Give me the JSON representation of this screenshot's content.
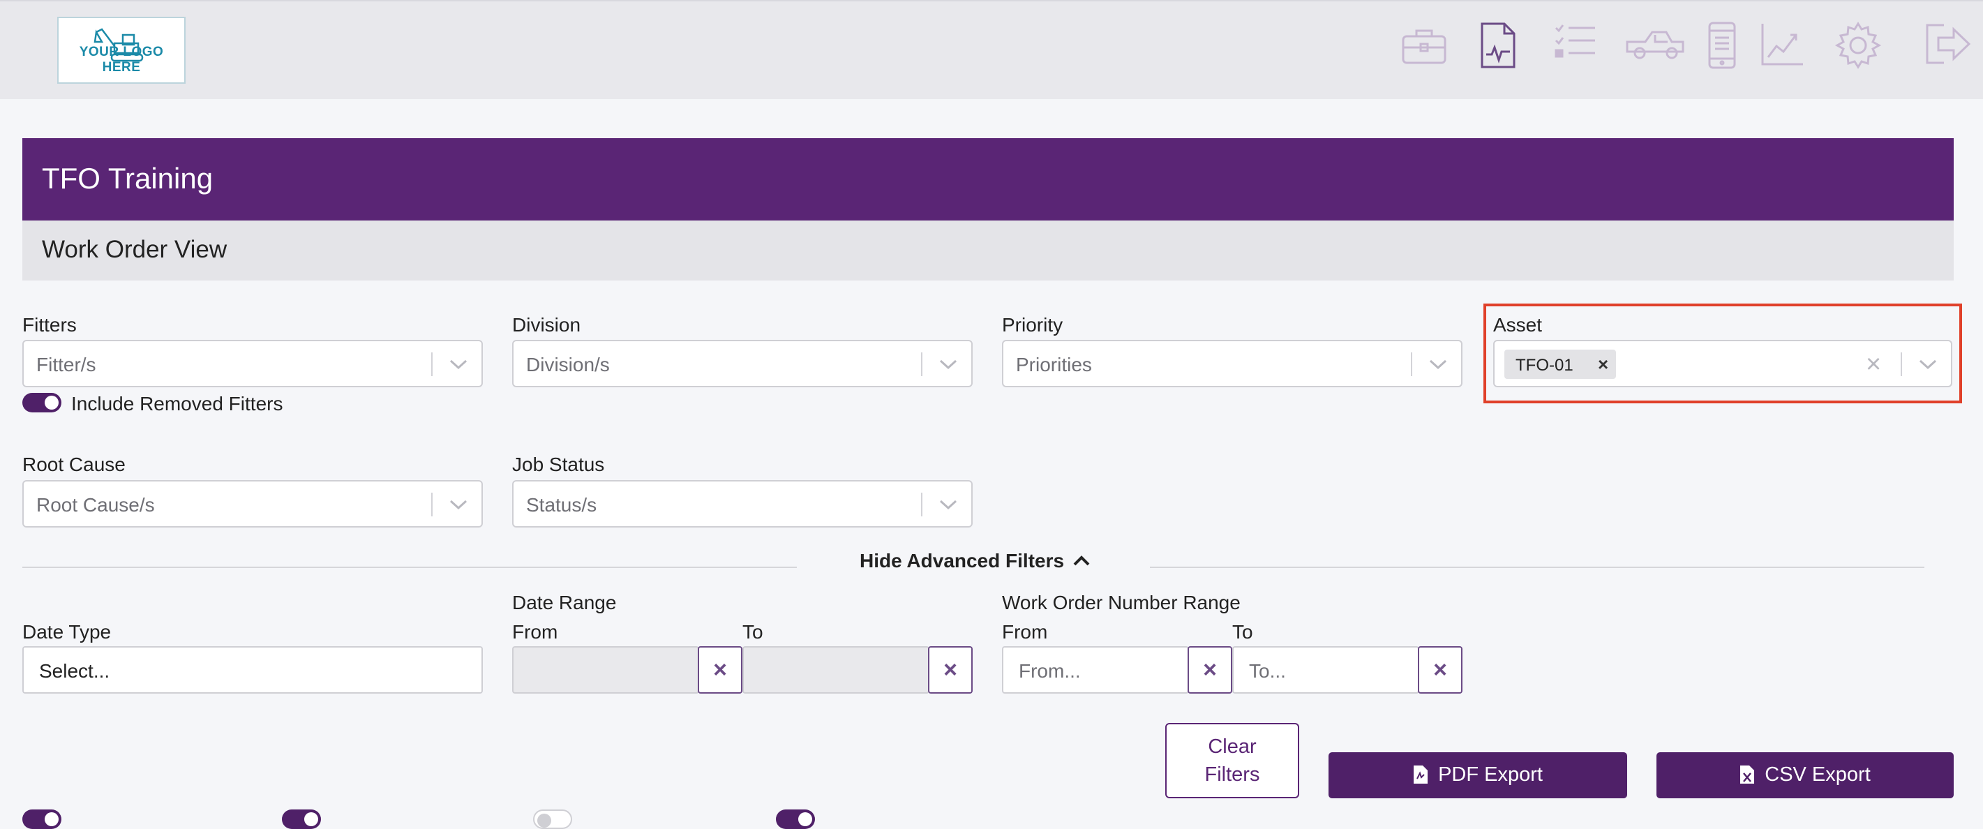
{
  "header": {
    "logo_text": "YOUR LOGO HERE",
    "nav_icons": [
      "toolbox-icon",
      "document-icon",
      "checklist-icon",
      "truck-icon",
      "mobile-icon",
      "chart-icon",
      "gear-icon",
      "logout-icon"
    ]
  },
  "banner": {
    "title": "TFO Training"
  },
  "subbar": {
    "title": "Work Order View"
  },
  "filters": {
    "fitters": {
      "label": "Fitters",
      "placeholder": "Fitter/s"
    },
    "division": {
      "label": "Division",
      "placeholder": "Division/s"
    },
    "priority": {
      "label": "Priority",
      "placeholder": "Priorities"
    },
    "asset": {
      "label": "Asset",
      "chip": "TFO-01",
      "chip_remove": "×",
      "clear": "×"
    },
    "include_removed": {
      "label": "Include Removed Fitters",
      "on": true
    },
    "root_cause": {
      "label": "Root Cause",
      "placeholder": "Root Cause/s"
    },
    "job_status": {
      "label": "Job Status",
      "placeholder": "Status/s"
    }
  },
  "advanced": {
    "toggle_label": "Hide Advanced Filters",
    "date_type": {
      "label": "Date Type",
      "value": "Select..."
    },
    "date_range": {
      "label": "Date Range",
      "from_label": "From",
      "to_label": "To",
      "clear": "×"
    },
    "wo_range": {
      "label": "Work Order Number Range",
      "from_label": "From",
      "to_label": "To",
      "from_placeholder": "From...",
      "to_placeholder": "To...",
      "clear": "×"
    }
  },
  "actions": {
    "clear_filters": [
      "Clear",
      "Filters"
    ],
    "pdf_export": "PDF Export",
    "csv_export": "CSV Export"
  },
  "colors": {
    "brand_purple": "#5a2575",
    "highlight": "#e0402a"
  }
}
